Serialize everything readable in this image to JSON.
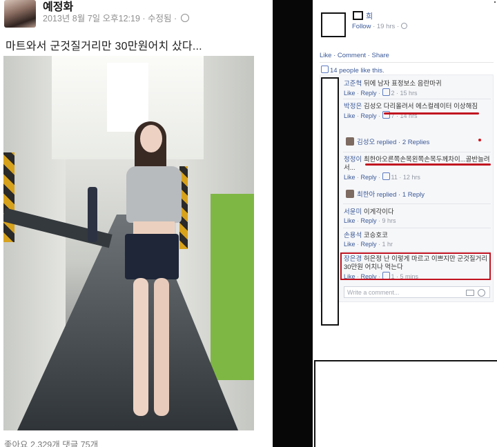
{
  "left_post": {
    "author": "예정화",
    "meta": "2013년 8월 7일 오후12:19 · 수정됨 ·",
    "text": "마트와서 군것질거리만 30만원어치 샀다...",
    "reactions": "좋아요 2,329개   댓글 75개",
    "icons": [
      "avatar",
      "globe-icon"
    ]
  },
  "right_post": {
    "name_suffix": "희",
    "follow": "Follow",
    "time": " · 19 hrs · ",
    "actions": "Like · Comment · Share",
    "likes_count": "14 people like this.",
    "comments": [
      {
        "name": "고준혁",
        "text": "뒤에 남자 표정보소 음란마귀",
        "likes": "2",
        "time": "15 hrs"
      },
      {
        "name": "박정은",
        "text": "김성오 다리올려서 에스컬레이터 이상해짐",
        "likes": "7",
        "time": "14 hrs"
      },
      {
        "reply": "김성오 replied · 2 Replies"
      },
      {
        "name": "정정이",
        "text": "최한아오른쪽손목왼쪽손목두께차이...골반늘려서...",
        "likes": "11",
        "time": "12 hrs"
      },
      {
        "reply": "최한아 replied · 1 Reply"
      },
      {
        "name": "서윤미",
        "text": "이게각이다",
        "time": "9 hrs"
      },
      {
        "name": "손용석",
        "text": "코승호코",
        "time": "1 hr"
      },
      {
        "name": "장은경",
        "text": "허은정 난 이렇게 마르고 이쁘지만 군것질거리 30만원 어치나 먹는다",
        "likes": "1",
        "time": "5 mins"
      }
    ],
    "like_label": "Like",
    "reply_label": "Reply",
    "write_placeholder": "Write a comment...",
    "accent": "#3b5998",
    "highlight": "#c1121f"
  }
}
